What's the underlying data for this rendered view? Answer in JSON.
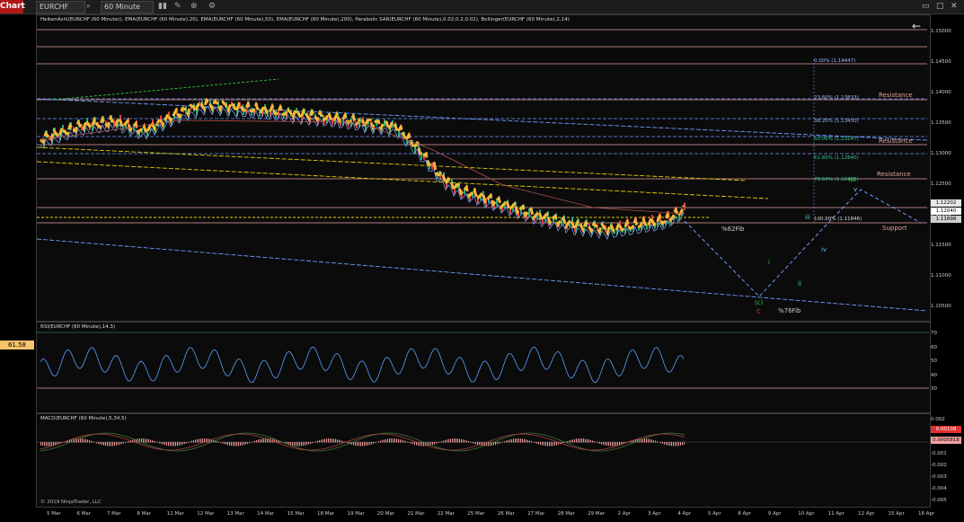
{
  "toolbar": {
    "chart_label": "Chart",
    "instrument": "EURCHF",
    "search_icon": "search-icon",
    "interval": "60 Minute",
    "window_icons": [
      "restore-icon",
      "maximize-icon",
      "close-icon"
    ]
  },
  "price_pane": {
    "title": "HeikenAshi(EURCHF (60 Minute)), EMA(EURCHF (60 Minute),20), EMA(EURCHF (60 Minute),50), EMA(EURCHF (60 Minute),200), Parabolic SAR(EURCHF (60 Minute),0.02,0.2,0.02), Bollinger(EURCHF (60 Minute),2,14)",
    "y_ticks": [
      "1.15000",
      "1.14500",
      "1.14000",
      "1.13500",
      "1.13000",
      "1.12500",
      "1.12000",
      "1.11500",
      "1.11000",
      "1.10500"
    ],
    "price_boxes": [
      {
        "value": "1.12202",
        "color": "#e8e8e8"
      },
      {
        "value": "1.12040",
        "color": "#ffffff"
      },
      {
        "value": "1.11898",
        "color": "#cfcfcf"
      }
    ],
    "annotations": {
      "resistance_1": "Resistance",
      "resistance_2": "Resistance",
      "resistance_3": "Resistance",
      "support": "Support",
      "fib62": "%62Fib",
      "fib76": "%76Fib",
      "wave_c_small": "(c)",
      "wave_c_big": "C",
      "wave_i": "i",
      "wave_ii": "ii",
      "wave_iii": "iii",
      "wave_iv": "iv",
      "wave_v": "v",
      "wave_b": "(b)"
    },
    "fib_labels": [
      "0.00% (1.14447)",
      "23.60% (1.13833)",
      "38.20% (1.13450)",
      "50.00% (1.13147)",
      "61.80% (1.12840)",
      "78.60% (1.12405)",
      "100.00% (1.11846)"
    ],
    "back_arrow_icon": "back-arrow-icon"
  },
  "rsi_pane": {
    "title": "RSI(EURCHF (60 Minute),14,3)",
    "current": "61.58",
    "y_ticks": [
      "70",
      "60",
      "50",
      "40",
      "30"
    ]
  },
  "macd_pane": {
    "title": "MACD(EURCHF (60 Minute),5,34,5)",
    "y_ticks": [
      "0.002",
      "0.001",
      "0",
      "-0.001",
      "-0.002",
      "-0.003",
      "-0.004",
      "-0.005"
    ],
    "value_boxes": [
      "0.00108",
      "0.0000818"
    ],
    "copyright": "© 2019 NinjaTrader, LLC"
  },
  "x_axis": [
    "5 Mar",
    "6 Mar",
    "7 Mar",
    "8 Mar",
    "11 Mar",
    "12 Mar",
    "13 Mar",
    "14 Mar",
    "15 Mar",
    "18 Mar",
    "19 Mar",
    "20 Mar",
    "21 Mar",
    "22 Mar",
    "25 Mar",
    "26 Mar",
    "27 Mar",
    "28 Mar",
    "29 Mar",
    "2 Apr",
    "3 Apr",
    "4 Apr",
    "5 Apr",
    "8 Apr",
    "9 Apr",
    "10 Apr",
    "11 Apr",
    "12 Apr",
    "15 Apr",
    "16 Apr"
  ],
  "colors": {
    "accent": "#b01818",
    "ema": "#f5b83a",
    "resistance": "#e6a0a0",
    "fib": "#6f9bff",
    "trend_yellow": "#e0d000",
    "wave_blue": "#6f9bff",
    "rsi_line": "#5aa0ff"
  }
}
